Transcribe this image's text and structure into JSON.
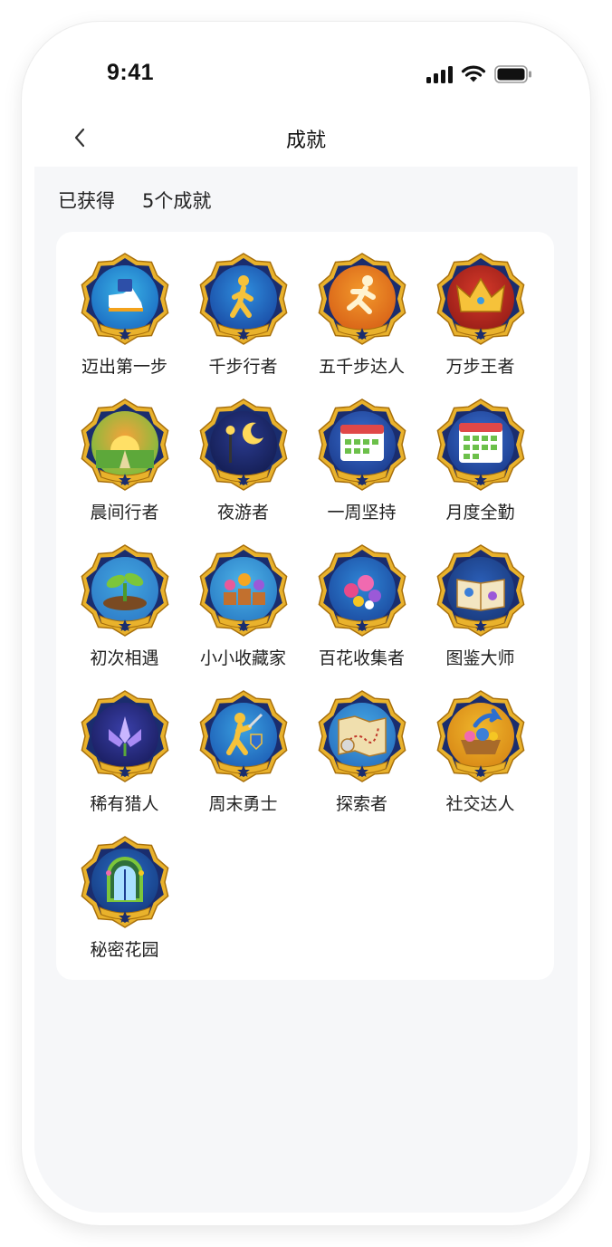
{
  "status_bar": {
    "time": "9:41"
  },
  "nav": {
    "title": "成就"
  },
  "summary": {
    "prefix": "已获得",
    "count_text": "5个成就"
  },
  "colors": {
    "gold": "#e9b22c",
    "navy": "#1a2d6e",
    "page_bg": "#f6f7f9"
  },
  "achievements": [
    {
      "label": "迈出第一步",
      "icon": "sneaker-step-icon",
      "bg": "#3ab4e6",
      "bg2": "#1d6fc4"
    },
    {
      "label": "千步行者",
      "icon": "walking-person-icon",
      "bg": "#2f8fde",
      "bg2": "#1b4fa8"
    },
    {
      "label": "五千步达人",
      "icon": "running-person-icon",
      "bg": "#f39a2c",
      "bg2": "#d96418"
    },
    {
      "label": "万步王者",
      "icon": "crown-icon",
      "bg": "#d63a2a",
      "bg2": "#9a1e18"
    },
    {
      "label": "晨间行者",
      "icon": "sunrise-icon",
      "bg": "#f7a23a",
      "bg2": "#7bbd3e"
    },
    {
      "label": "夜游者",
      "icon": "moon-lamp-icon",
      "bg": "#2a3a8e",
      "bg2": "#151f55"
    },
    {
      "label": "一周坚持",
      "icon": "week-calendar-icon",
      "bg": "#3b6fd0",
      "bg2": "#1d3f91"
    },
    {
      "label": "月度全勤",
      "icon": "month-calendar-icon",
      "bg": "#3b6fd0",
      "bg2": "#1d3f91"
    },
    {
      "label": "初次相遇",
      "icon": "sprout-icon",
      "bg": "#42a7e0",
      "bg2": "#2f7ec9"
    },
    {
      "label": "小小收藏家",
      "icon": "potted-flowers-icon",
      "bg": "#4fb4e8",
      "bg2": "#2b7fc7"
    },
    {
      "label": "百花收集者",
      "icon": "flower-bouquet-icon",
      "bg": "#2f86d6",
      "bg2": "#1d4ea3"
    },
    {
      "label": "图鉴大师",
      "icon": "flower-book-icon",
      "bg": "#2b5fb8",
      "bg2": "#1a3b7e"
    },
    {
      "label": "稀有猎人",
      "icon": "crystal-lotus-icon",
      "bg": "#3a3fa8",
      "bg2": "#1b1f63"
    },
    {
      "label": "周末勇士",
      "icon": "warrior-icon",
      "bg": "#3aa0e0",
      "bg2": "#1f62b8"
    },
    {
      "label": "探索者",
      "icon": "treasure-map-icon",
      "bg": "#45a8e4",
      "bg2": "#2a74c2"
    },
    {
      "label": "社交达人",
      "icon": "share-basket-icon",
      "bg": "#f0b82c",
      "bg2": "#d98a17"
    },
    {
      "label": "秘密花园",
      "icon": "garden-gate-icon",
      "bg": "#2a6cc4",
      "bg2": "#173f86"
    }
  ]
}
